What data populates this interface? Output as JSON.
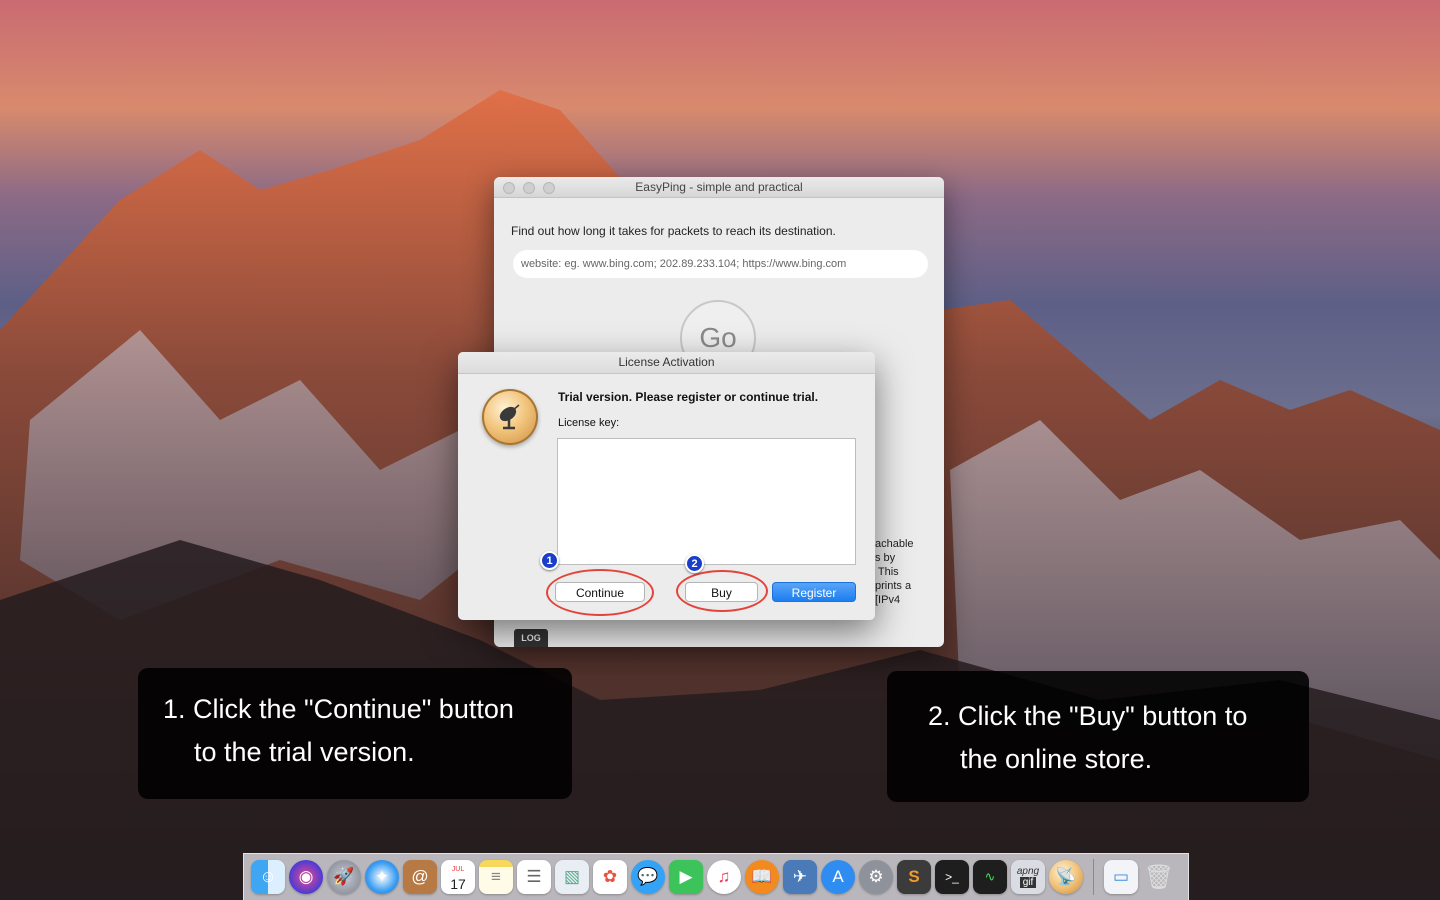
{
  "main_window": {
    "title": "EasyPing - simple and practical",
    "description": "Find out how long it takes for packets to reach its destination.",
    "url_placeholder": "website: eg. www.bing.com; 202.89.233.104; https://www.bing.com",
    "go_label": "Go",
    "partial_text": "achable\ns by\n This\nprints a\n[IPv4",
    "log_tab": "LOG"
  },
  "dialog": {
    "title": "License Activation",
    "heading": "Trial version. Please register or continue trial.",
    "key_label": "License key:",
    "buttons": {
      "continue": "Continue",
      "buy": "Buy",
      "register": "Register"
    }
  },
  "annotations": {
    "badge_1": "1",
    "badge_2": "2",
    "callout_1": {
      "line1": "1. Click the \"Continue\" button",
      "line2": "to the trial version."
    },
    "callout_2": {
      "line1": "2. Click the \"Buy\" button to",
      "line2": "the online store."
    },
    "ring_color": "#e3443a",
    "badge_color": "#1a3dcc"
  },
  "dock": {
    "calendar_month": "JUL",
    "calendar_day": "17",
    "apng_label": "apng",
    "gif_label": "gif",
    "icons": [
      "finder-icon",
      "siri-icon",
      "launchpad-icon",
      "safari-icon",
      "contacts-icon",
      "calendar-icon",
      "notes-icon",
      "reminders-icon",
      "preview-icon",
      "photos-icon",
      "messages-icon",
      "facetime-icon",
      "itunes-icon",
      "ibooks-icon",
      "preview-photo-icon",
      "app-store-icon",
      "system-preferences-icon",
      "sublime-icon",
      "terminal-icon",
      "activity-monitor-icon",
      "apng-gif-icon",
      "easyping-icon",
      "downloads-stack-icon",
      "trash-icon"
    ]
  }
}
